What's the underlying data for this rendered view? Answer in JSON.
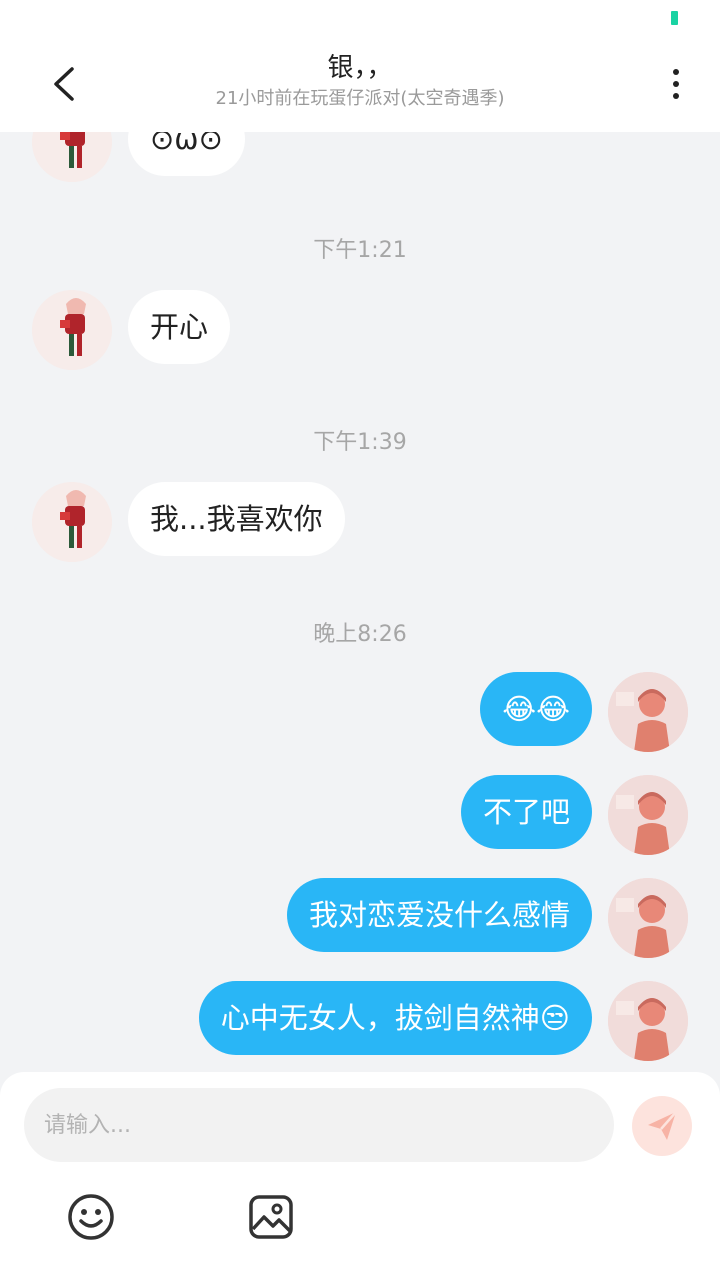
{
  "header": {
    "title": "银，，",
    "subtitle": "21小时前在玩蛋仔派对(太空奇遇季)"
  },
  "messages": [
    {
      "side": "left",
      "text": "⊙ω⊙"
    },
    {
      "type": "time",
      "text": "下午1:21"
    },
    {
      "side": "left",
      "text": "开心"
    },
    {
      "type": "time",
      "text": "下午1:39"
    },
    {
      "side": "left",
      "text": "我...我喜欢你"
    },
    {
      "type": "time",
      "text": "晚上8:26"
    },
    {
      "side": "right",
      "text": "😂😂"
    },
    {
      "side": "right",
      "text": "不了吧"
    },
    {
      "side": "right",
      "text": "我对恋爱没什么感情"
    },
    {
      "side": "right",
      "text": "心中无女人，拔剑自然神😒"
    }
  ],
  "input": {
    "placeholder": "请输入..."
  },
  "icons": {
    "back": "back-arrow-icon",
    "more": "more-vertical-icon",
    "send": "send-icon",
    "emoji": "smiley-icon",
    "image": "image-icon"
  },
  "colors": {
    "accent": "#29b6f6",
    "background": "#f2f3f5",
    "status": "#19d3a3"
  }
}
